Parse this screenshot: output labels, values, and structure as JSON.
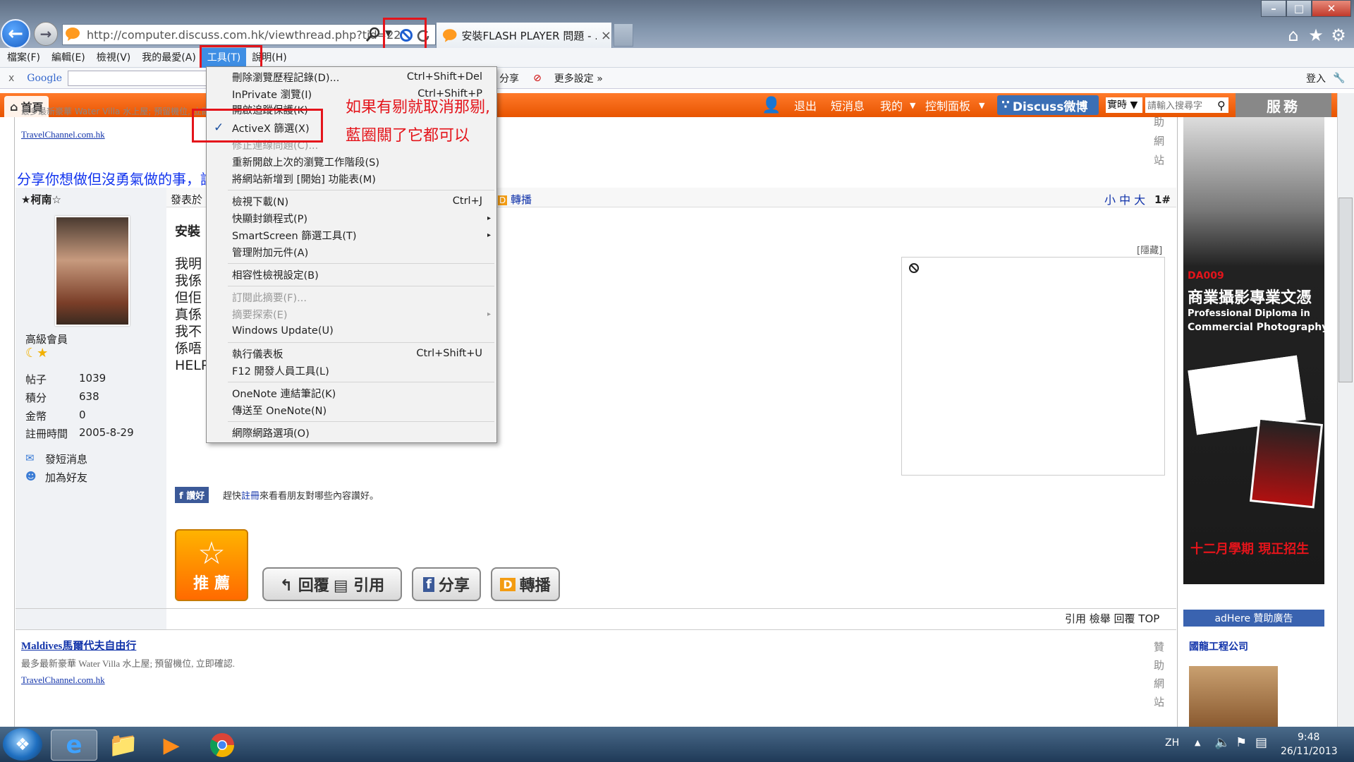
{
  "browser": {
    "address_url": "http://computer.discuss.com.hk/viewthread.php?tid=22",
    "address_host": "computer.discuss.com.hk",
    "tab_title": "安裝FLASH PLAYER 問題 - ...",
    "tab_close": "×"
  },
  "menubar": {
    "items": [
      "檔案(F)",
      "編輯(E)",
      "檢視(V)",
      "我的最愛(A)",
      "工具(T)",
      "說明(H)"
    ]
  },
  "googlebar": {
    "close": "x",
    "brand": "Google",
    "right_items": [
      "分享",
      "更多設定 »"
    ],
    "login": "登入"
  },
  "sitenav": {
    "home": "首頁",
    "items": [
      "退出",
      "短消息",
      "我的",
      "控制面板"
    ],
    "weibo": "Discuss微博",
    "search_scope": "實時",
    "search_placeholder": "請輸入搜尋字",
    "service": "服務"
  },
  "tools_menu": {
    "items": [
      {
        "label": "刪除瀏覽歷程記錄(D)...",
        "shortcut": "Ctrl+Shift+Del"
      },
      {
        "label": "InPrivate 瀏覽(I)",
        "shortcut": "Ctrl+Shift+P"
      },
      {
        "label": "開啟追蹤保護(K)",
        "shortcut": ""
      },
      {
        "label": "ActiveX 篩選(X)",
        "shortcut": ""
      },
      {
        "label": "修正連線問題(C)...",
        "shortcut": ""
      },
      {
        "label": "重新開啟上次的瀏覽工作階段(S)",
        "shortcut": ""
      },
      {
        "label": "將網站新增到 [開始] 功能表(M)",
        "shortcut": ""
      },
      {
        "label": "檢視下載(N)",
        "shortcut": "Ctrl+J"
      },
      {
        "label": "快顯封鎖程式(P)",
        "shortcut": "▸"
      },
      {
        "label": "SmartScreen 篩選工具(T)",
        "shortcut": "▸"
      },
      {
        "label": "管理附加元件(A)",
        "shortcut": ""
      },
      {
        "label": "相容性檢視設定(B)",
        "shortcut": ""
      },
      {
        "label": "訂閱此摘要(F)...",
        "shortcut": ""
      },
      {
        "label": "摘要探索(E)",
        "shortcut": "▸"
      },
      {
        "label": "Windows Update(U)",
        "shortcut": ""
      },
      {
        "label": "執行儀表板",
        "shortcut": "Ctrl+Shift+U"
      },
      {
        "label": "F12 開發人員工具(L)",
        "shortcut": ""
      },
      {
        "label": "OneNote 連結筆記(K)",
        "shortcut": ""
      },
      {
        "label": "傳送至 OneNote(N)",
        "shortcut": ""
      },
      {
        "label": "網際網路選項(O)",
        "shortcut": ""
      }
    ],
    "checkmark": "✓"
  },
  "annotation": {
    "line1": "如果有剔就取消那剔,",
    "line2": "藍圈關了它都可以"
  },
  "page": {
    "top_ad_link": "TravelChannel.com.hk",
    "top_ad_text": "最多最新豪華 Water Villa 水上屋; 預留機位, 立即確認.",
    "share_banner": "分享你想做但沒勇氣做的事，說",
    "side_vertical_top": [
      "助",
      "網",
      "站"
    ],
    "username": "★柯南☆",
    "posted_at": "發表於",
    "reshare": "轉播",
    "font_sizes": "小 中 大",
    "floor": "1#",
    "rank": "高級會員",
    "stats_labels": [
      "帖子",
      "積分",
      "金幣",
      "註冊時間"
    ],
    "stats_values": [
      "1039",
      "638",
      "0",
      "2005-8-29"
    ],
    "send_msg": "發短消息",
    "add_friend": "加為好友",
    "post_title": "安裝",
    "post_lines": [
      "我明",
      "我係",
      "但佢",
      "真係",
      "我不",
      "係唔",
      "HELP"
    ],
    "hide": "[隱藏]",
    "fb_like": "讚好",
    "fb_text_pre": "趕快",
    "fb_register": "註冊",
    "fb_text_post": "來看看朋友對哪些內容讚好。",
    "recommend": "推 薦",
    "reply": "回覆",
    "quote": "引用",
    "share": "分享",
    "forward": "轉播",
    "post_actions": "引用 檢舉 回覆 TOP",
    "bottom_ad_title": "Maldives馬爾代夫自由行",
    "bottom_ad_text": "最多最新豪華 Water Villa 水上屋; 預留機位, 立即確認.",
    "bottom_ad_link": "TravelChannel.com.hk",
    "side_vertical_bottom": [
      "贊",
      "助",
      "網",
      "站"
    ]
  },
  "right_ad": {
    "code": "DA009",
    "title": "商業攝影專業文憑",
    "en1": "Professional Diploma in",
    "en2": "Commercial Photography",
    "footer": "十二月學期 現正招生",
    "sponsor": "adHere 贊助廣告",
    "company": "國龍工程公司"
  },
  "taskbar": {
    "lang": "ZH",
    "time": "9:48",
    "date": "26/11/2013"
  },
  "colors": {
    "accent_orange": "#e85400",
    "highlight_red": "#e4141b",
    "menu_blue": "#3e8ee4"
  }
}
